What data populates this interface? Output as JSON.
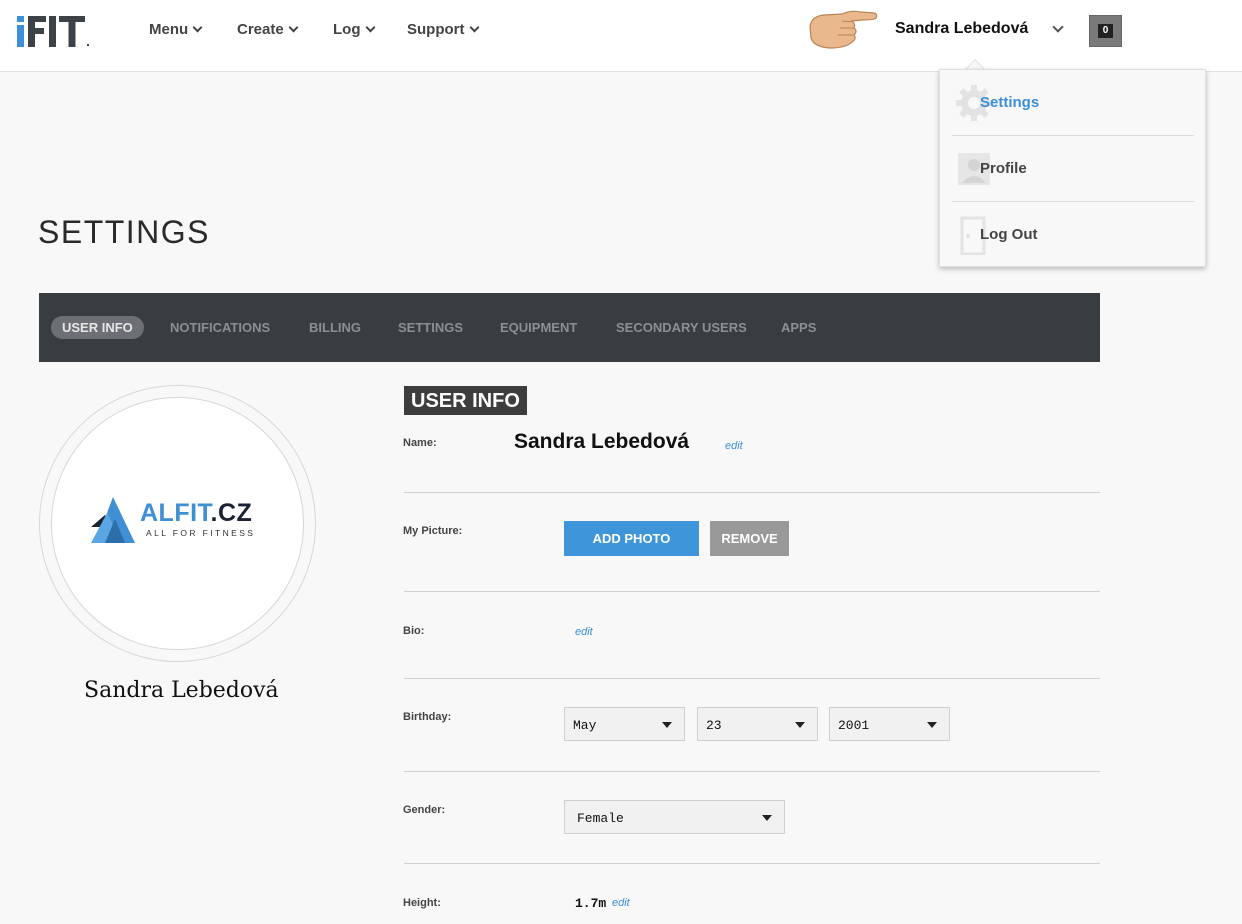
{
  "header": {
    "logo_text": "iFIT",
    "nav": [
      {
        "label": "Menu"
      },
      {
        "label": "Create"
      },
      {
        "label": "Log"
      },
      {
        "label": "Support"
      }
    ],
    "user_name": "Sandra Lebedová",
    "cart_count": "0"
  },
  "dropdown": {
    "items": [
      {
        "label": "Settings",
        "icon": "gear-icon",
        "active": true
      },
      {
        "label": "Profile",
        "icon": "person-icon"
      },
      {
        "label": "Log Out",
        "icon": "door-icon"
      }
    ]
  },
  "page": {
    "title": "SETTINGS"
  },
  "tabs": [
    {
      "label": "USER INFO",
      "active": true
    },
    {
      "label": "NOTIFICATIONS"
    },
    {
      "label": "BILLING"
    },
    {
      "label": "SETTINGS"
    },
    {
      "label": "EQUIPMENT"
    },
    {
      "label": "SECONDARY USERS"
    },
    {
      "label": "APPS"
    }
  ],
  "profile": {
    "logo_main": "ALFIT",
    "logo_tld": ".CZ",
    "logo_sub": "ALL FOR FITNESS",
    "name": "Sandra Lebedová"
  },
  "form": {
    "section_title": "USER INFO",
    "name_label": "Name:",
    "name_value": "Sandra Lebedová",
    "edit_label": "edit",
    "picture_label": "My Picture:",
    "add_photo": "ADD PHOTO",
    "remove": "REMOVE",
    "bio_label": "Bio:",
    "birthday_label": "Birthday:",
    "birthday_month": "May",
    "birthday_day": "23",
    "birthday_year": "2001",
    "gender_label": "Gender:",
    "gender_value": "Female",
    "height_label": "Height:",
    "height_value": "1.7m"
  },
  "colors": {
    "accent_blue": "#3f95da",
    "tabbar_bg": "#393d40",
    "remove_gray": "#999999"
  }
}
